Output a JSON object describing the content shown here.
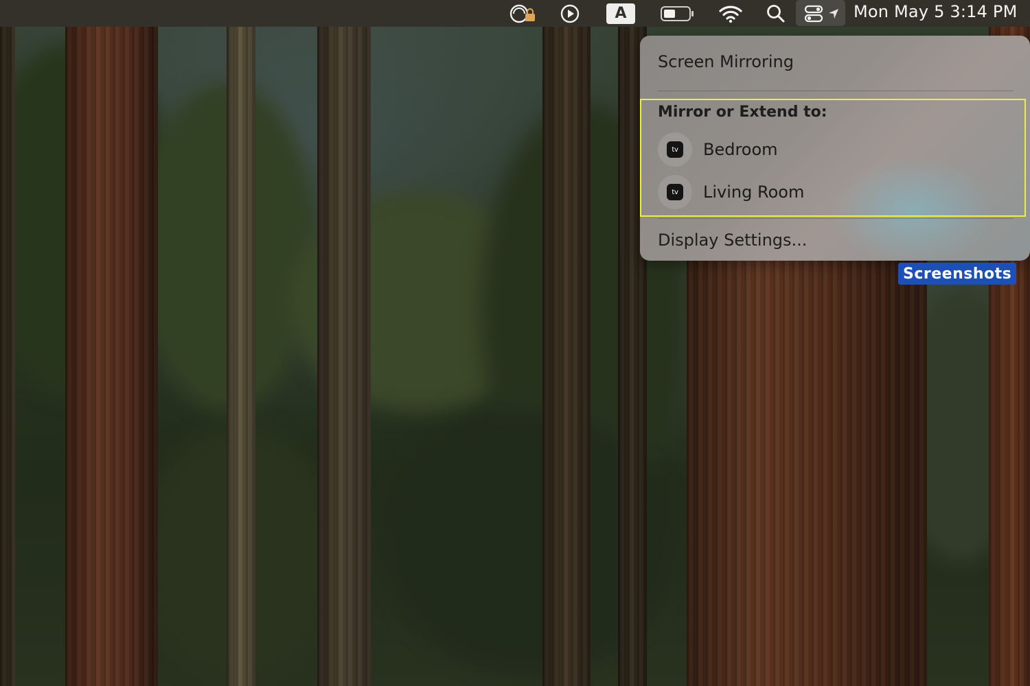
{
  "menubar": {
    "icons": [
      "cloud-lock-icon",
      "play-icon",
      "input-source-icon",
      "battery-icon",
      "wifi-icon",
      "search-icon",
      "control-center-icon",
      "location-arrow-icon"
    ],
    "input_source_letter": "A",
    "clock": "Mon May 5  3:14 PM"
  },
  "panel": {
    "title": "Screen Mirroring",
    "section_label": "Mirror or Extend to:",
    "devices": [
      {
        "label": "Bedroom",
        "icon": "apple-tv-icon",
        "icon_text": "tv"
      },
      {
        "label": "Living Room",
        "icon": "apple-tv-icon",
        "icon_text": "tv"
      }
    ],
    "settings_label": "Display Settings...",
    "highlight_color": "#eef13c"
  },
  "desktop": {
    "tag_label": "Screenshots",
    "tag_color": "#1c4fb8"
  }
}
